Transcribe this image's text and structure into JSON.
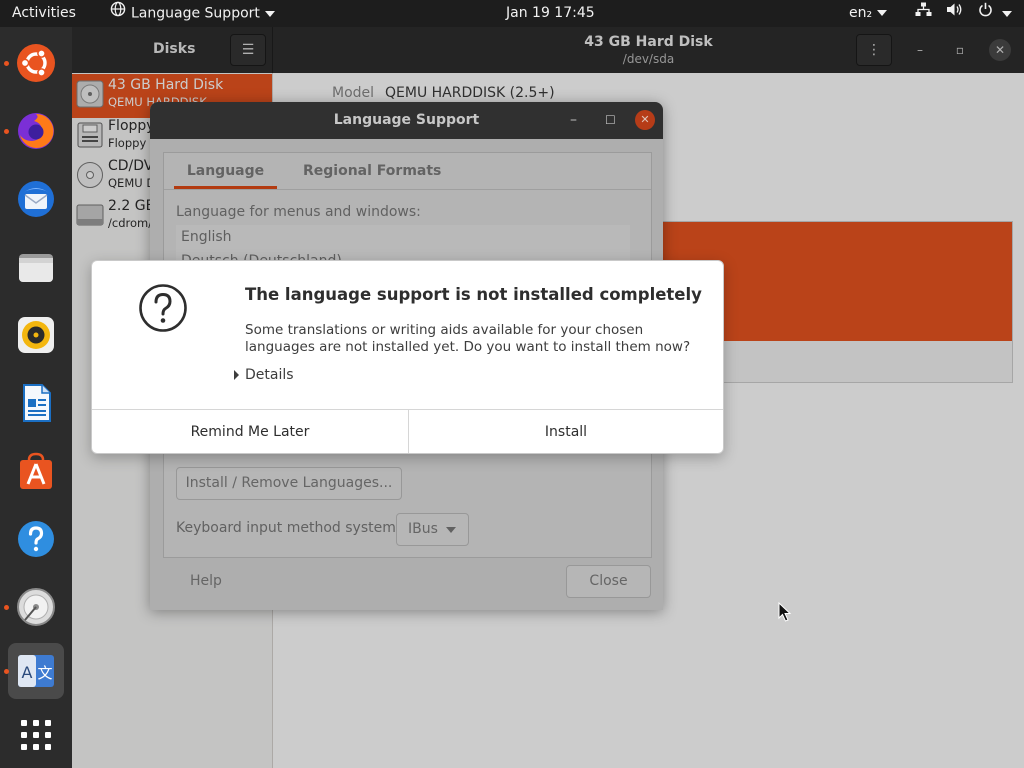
{
  "topbar": {
    "activities": "Activities",
    "app_menu": "Language Support",
    "clock": "Jan 19  17:45",
    "keyboard_layout": "en₂"
  },
  "dock": {
    "apps": [
      "ubuntu-logo-icon",
      "firefox-icon",
      "thunderbird-icon",
      "files-icon",
      "rhythmbox-icon",
      "libreoffice-writer-icon",
      "ubuntu-software-icon",
      "help-icon",
      "disks-icon",
      "language-support-icon",
      "show-apps-icon"
    ]
  },
  "disks": {
    "sidebar_title": "Disks",
    "header_title": "43 GB Hard Disk",
    "header_subtitle": "/dev/sda",
    "model_label": "Model",
    "model_value": "QEMU HARDDISK (2.5+)",
    "drives": [
      {
        "name": "43 GB Hard Disk",
        "sub": "QEMU HARDDISK",
        "selected": true
      },
      {
        "name": "Floppy",
        "sub": "Floppy D",
        "selected": false
      },
      {
        "name": "CD/DV",
        "sub": "QEMU D",
        "selected": false
      },
      {
        "name": "2.2 GB",
        "sub": "/cdrom/",
        "selected": false
      }
    ]
  },
  "language_support": {
    "title": "Language Support",
    "tabs": [
      "Language",
      "Regional Formats"
    ],
    "menus_label": "Language for menus and windows:",
    "languages": [
      "English",
      "Deutsch (Deutschland)"
    ],
    "install_remove": "Install / Remove Languages...",
    "input_method_label": "Keyboard input method system:",
    "input_method_value": "IBus",
    "help": "Help",
    "close": "Close"
  },
  "dialog": {
    "title": "The language support is not installed completely",
    "message": "Some translations or writing aids available for your chosen languages are not installed yet. Do you want to install them now?",
    "details": "Details",
    "remind_later": "Remind Me Later",
    "install": "Install"
  },
  "colors": {
    "accent": "#e95420",
    "topbar": "#1d1d1d",
    "dock": "#2c2c2c"
  }
}
